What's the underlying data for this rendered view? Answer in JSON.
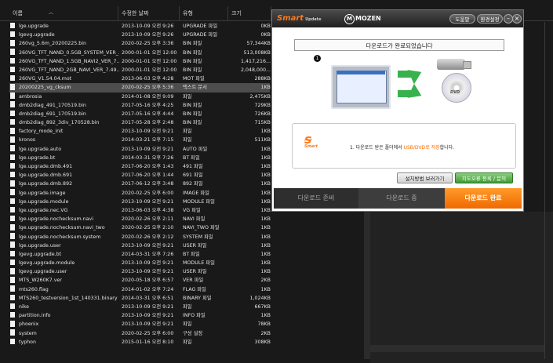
{
  "explorer": {
    "columns": {
      "name": "이름",
      "date": "수정한 날짜",
      "type": "유형",
      "size": "크기"
    },
    "files": [
      {
        "name": "lge.upgrade",
        "date": "2013-10-09 오전 9:26",
        "type": "UPGRADE 파일",
        "size": "0KB",
        "icon": "file-icon"
      },
      {
        "name": "lgevg.upgrade",
        "date": "2013-10-09 오전 9:26",
        "type": "UPGRADE 파일",
        "size": "0KB",
        "icon": "file-icon"
      },
      {
        "name": "260vg_5.6m_20200225.bin",
        "date": "2020-02-25 오후 3:36",
        "type": "BIN 파일",
        "size": "57,344KB",
        "icon": "file-icon"
      },
      {
        "name": "260VG_TFT_NAND_0.5GB_SYSTEM_VER_...",
        "date": "2000-01-01 오전 12:00",
        "type": "BIN 파일",
        "size": "513,008KB",
        "icon": "file-icon"
      },
      {
        "name": "260VG_TFT_NAND_1.5GB_NAVI2_VER_7...",
        "date": "2000-01-01 오전 12:00",
        "type": "BIN 파일",
        "size": "1,417,216...",
        "icon": "file-icon"
      },
      {
        "name": "260VG_TFT_NAND_2GB_NAVI_VER_7.49...",
        "date": "2000-01-01 오전 12:00",
        "type": "BIN 파일",
        "size": "2,048,000...",
        "icon": "file-icon"
      },
      {
        "name": "260VG_V1.54.04.mot",
        "date": "2013-06-03 오후 4:28",
        "type": "MOT 파일",
        "size": "288KB",
        "icon": "file-icon"
      },
      {
        "name": "20200225_vg_cksum",
        "date": "2020-02-25 오후 5:36",
        "type": "텍스트 문서",
        "size": "1KB",
        "icon": "file-icon",
        "selected": true
      },
      {
        "name": "ambrosia",
        "date": "2014-01-08 오전 9:09",
        "type": "파일",
        "size": "2,475KB",
        "icon": "file-icon"
      },
      {
        "name": "dmb2diag_491_170519.bin",
        "date": "2017-05-16 오후 4:25",
        "type": "BIN 파일",
        "size": "729KB",
        "icon": "file-icon"
      },
      {
        "name": "dmb2diag_691_170519.bin",
        "date": "2017-05-16 오후 4:44",
        "type": "BIN 파일",
        "size": "726KB",
        "icon": "file-icon"
      },
      {
        "name": "dmb2diag_892_3div_170528.bin",
        "date": "2017-05-28 오후 2:48",
        "type": "BIN 파일",
        "size": "715KB",
        "icon": "file-icon"
      },
      {
        "name": "factory_mode_init",
        "date": "2013-10-09 오전 9:21",
        "type": "파일",
        "size": "1KB",
        "icon": "file-icon"
      },
      {
        "name": "kronos",
        "date": "2014-03-21 오후 7:15",
        "type": "파일",
        "size": "511KB",
        "icon": "file-icon"
      },
      {
        "name": "lge.upgrade.auto",
        "date": "2013-10-09 오전 9:21",
        "type": "AUTO 파일",
        "size": "1KB",
        "icon": "file-icon"
      },
      {
        "name": "lge.upgrade.bt",
        "date": "2014-03-31 오후 7:26",
        "type": "BT 파일",
        "size": "1KB",
        "icon": "file-icon"
      },
      {
        "name": "lge.upgrade.dmb.491",
        "date": "2017-06-20 오후 1:43",
        "type": "491 파일",
        "size": "1KB",
        "icon": "file-icon"
      },
      {
        "name": "lge.upgrade.dmb.691",
        "date": "2017-06-20 오후 1:44",
        "type": "691 파일",
        "size": "1KB",
        "icon": "file-icon"
      },
      {
        "name": "lge.upgrade.dmb.892",
        "date": "2017-06-12 오후 3:48",
        "type": "892 파일",
        "size": "1KB",
        "icon": "file-icon"
      },
      {
        "name": "lge.upgrade.image",
        "date": "2020-02-25 오후 6:00",
        "type": "IMAGE 파일",
        "size": "1KB",
        "icon": "file-icon"
      },
      {
        "name": "lge.upgrade.module",
        "date": "2013-10-09 오전 9:21",
        "type": "MODULE 파일",
        "size": "1KB",
        "icon": "file-icon"
      },
      {
        "name": "lge.upgrade.nec.VG",
        "date": "2013-06-03 오후 4:38",
        "type": "VG 파일",
        "size": "1KB",
        "icon": "file-icon"
      },
      {
        "name": "lge.upgrade.nochecksum.navi",
        "date": "2020-02-26 오후 2:11",
        "type": "NAVI 파일",
        "size": "1KB",
        "icon": "file-icon"
      },
      {
        "name": "lge.upgrade.nochecksum.navi_two",
        "date": "2020-02-25 오후 2:10",
        "type": "NAVI_TWO 파일",
        "size": "1KB",
        "icon": "file-icon"
      },
      {
        "name": "lge.upgrade.nochecksum.system",
        "date": "2020-02-26 오후 2:12",
        "type": "SYSTEM 파일",
        "size": "1KB",
        "icon": "file-icon"
      },
      {
        "name": "lge.upgrade.user",
        "date": "2013-10-09 오전 9:21",
        "type": "USER 파일",
        "size": "1KB",
        "icon": "file-icon"
      },
      {
        "name": "lgevg.upgrade.bt",
        "date": "2014-03-31 오후 7:26",
        "type": "BT 파일",
        "size": "1KB",
        "icon": "file-icon"
      },
      {
        "name": "lgevg.upgrade.module",
        "date": "2013-10-09 오전 9:21",
        "type": "MODULE 파일",
        "size": "1KB",
        "icon": "file-icon"
      },
      {
        "name": "lgevg.upgrade.user",
        "date": "2013-10-09 오전 9:21",
        "type": "USER 파일",
        "size": "1KB",
        "icon": "file-icon"
      },
      {
        "name": "MTS_W260K7.ver",
        "date": "2020-05-18 오후 6:57",
        "type": "VER 파일",
        "size": "2KB",
        "icon": "file-icon"
      },
      {
        "name": "mts260.flag",
        "date": "2014-01-02 오후 7:24",
        "type": "FLAG 파일",
        "size": "1KB",
        "icon": "file-icon"
      },
      {
        "name": "MTS260_testversion_1st_140331.binary",
        "date": "2014-03-31 오후 6:51",
        "type": "BINARY 파일",
        "size": "1,024KB",
        "icon": "file-icon"
      },
      {
        "name": "nike",
        "date": "2013-10-09 오전 9:21",
        "type": "파일",
        "size": "667KB",
        "icon": "file-icon"
      },
      {
        "name": "partition.info",
        "date": "2013-10-09 오전 9:21",
        "type": "INFO 파일",
        "size": "1KB",
        "icon": "file-icon"
      },
      {
        "name": "phoenix",
        "date": "2013-10-09 오전 9:21",
        "type": "파일",
        "size": "78KB",
        "icon": "file-icon"
      },
      {
        "name": "system",
        "date": "2020-02-25 오후 6:00",
        "type": "구성 설정",
        "size": "2KB",
        "icon": "settings-file-icon"
      },
      {
        "name": "typhon",
        "date": "2015-01-16 오전 8:10",
        "type": "파일",
        "size": "308KB",
        "icon": "file-icon"
      }
    ]
  },
  "app": {
    "logo_text": "Smart",
    "logo_sub": "Update",
    "brand": "MOZEN",
    "brand_initial": "M",
    "help_label": "도움말",
    "settings_label": "환경설정",
    "minimize_glyph": "–",
    "close_glyph": "×",
    "message": "다운로드가 완료되었습니다",
    "step_number": "1",
    "dvd_label": "DVD",
    "info_logo_sub": "Smart",
    "info_text_pre": "1. 다운로드 받은 폴더에서 ",
    "info_text_em": "USB/DVD로 저장",
    "info_text_post": "합니다.",
    "guide_button": "설치방법 보러가기",
    "report_button": "지도오류 등록 / 문의",
    "steps": [
      "다운로드 준비",
      "다운로드 중",
      "다운로드 완료"
    ],
    "colors": {
      "accent": "#ff7a1a",
      "green": "#37b24d",
      "active_step": "#f06a00"
    }
  }
}
